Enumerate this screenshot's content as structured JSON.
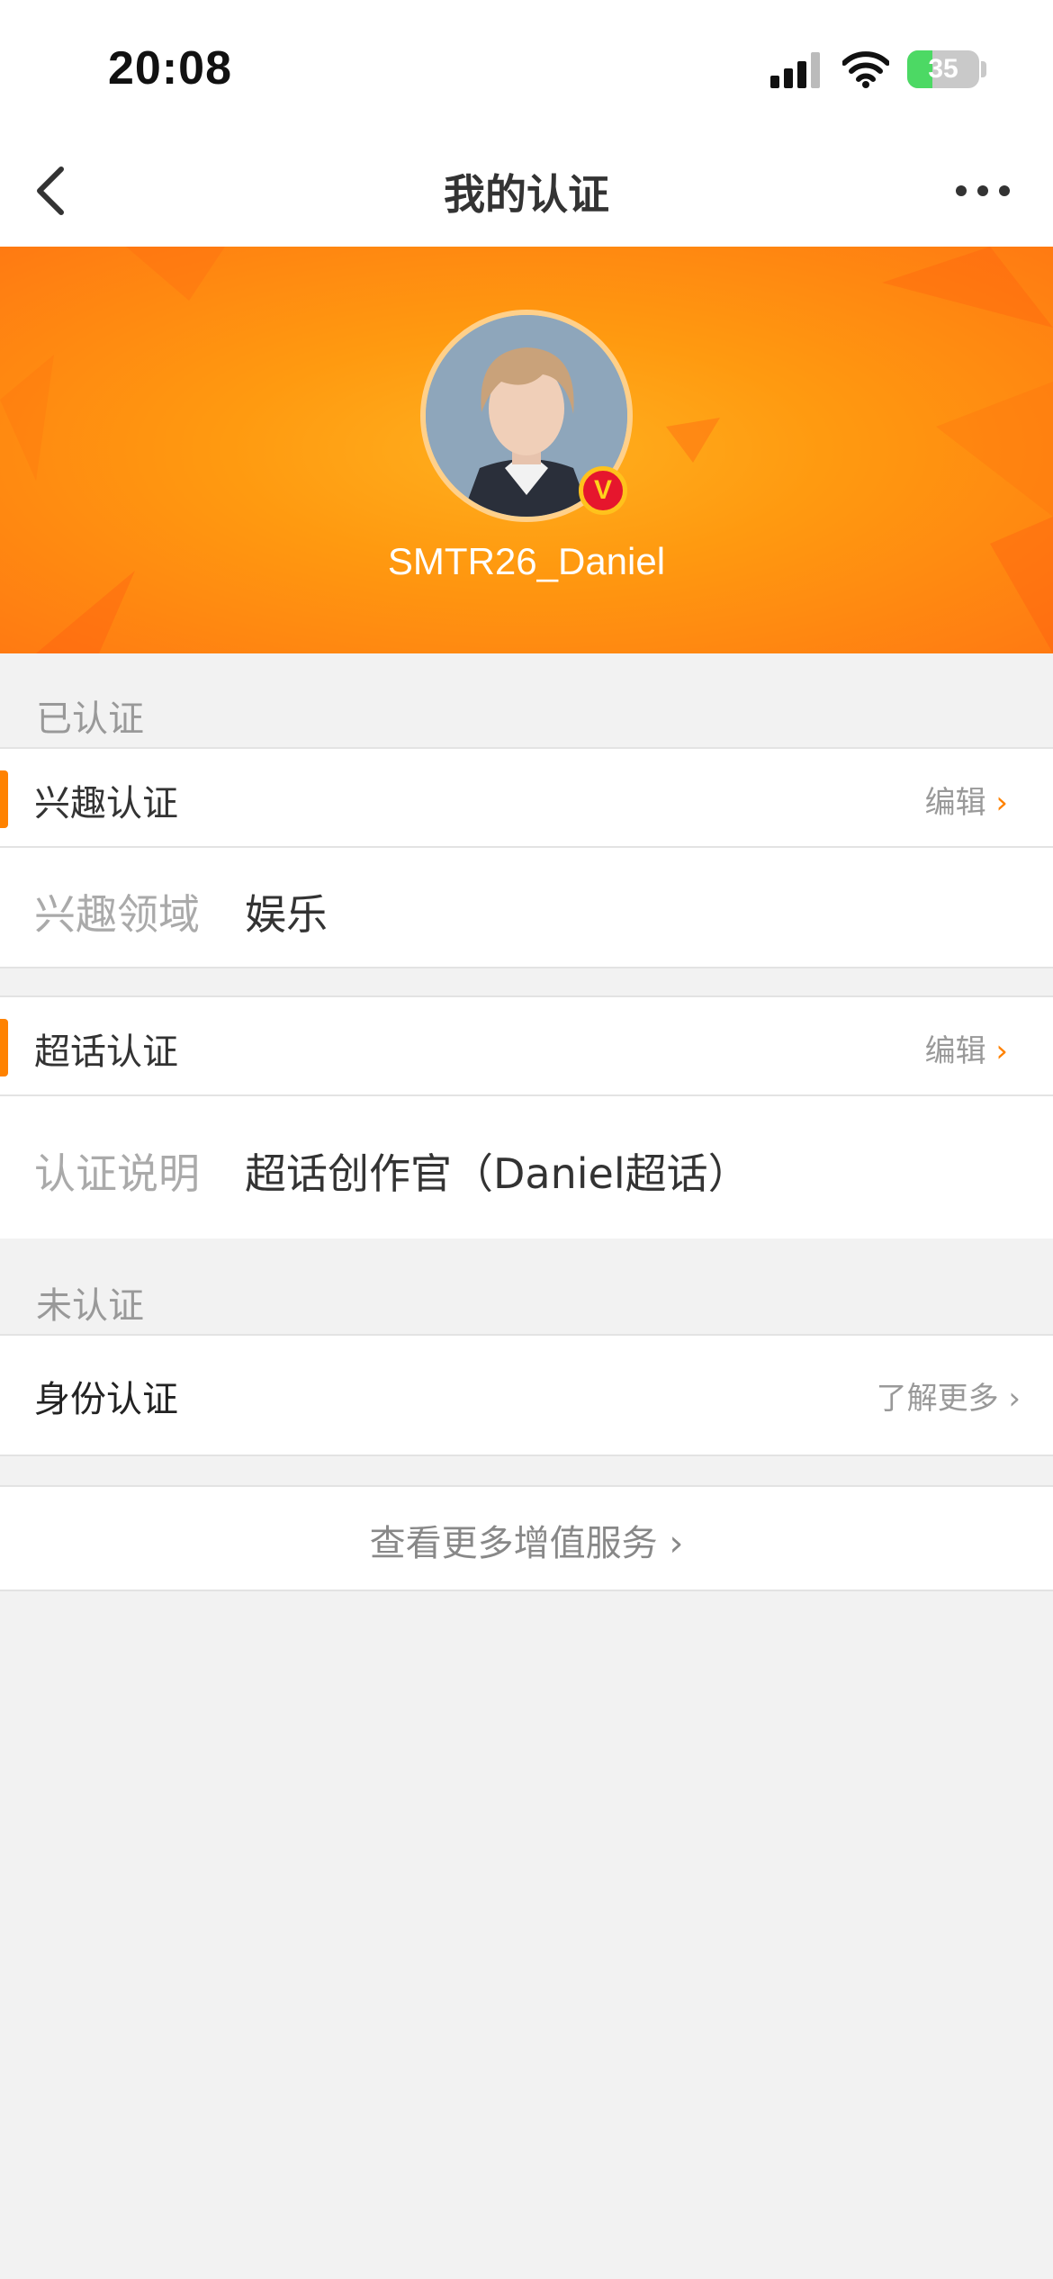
{
  "status_bar": {
    "time": "20:08",
    "battery": "35",
    "battery_level": 0.35
  },
  "nav": {
    "title": "我的认证"
  },
  "profile": {
    "username": "SMTR26_Daniel",
    "badge": "V"
  },
  "verified": {
    "header": "已认证",
    "interest": {
      "title": "兴趣认证",
      "action": "编辑",
      "label": "兴趣领域",
      "value": "娱乐"
    },
    "supertopic": {
      "title": "超话认证",
      "action": "编辑",
      "label": "认证说明",
      "value": "超话创作官（Daniel超话）"
    }
  },
  "unverified": {
    "header": "未认证",
    "identity": {
      "title": "身份认证",
      "action": "了解更多"
    }
  },
  "more_services": "查看更多增值服务",
  "colors": {
    "accent": "#ff8200",
    "background": "#f2f2f2",
    "hero": "#ff9a10"
  },
  "icons": {
    "back": "chevron-left-icon",
    "more": "more-dots-icon",
    "chevron": "chevron-right-icon"
  }
}
